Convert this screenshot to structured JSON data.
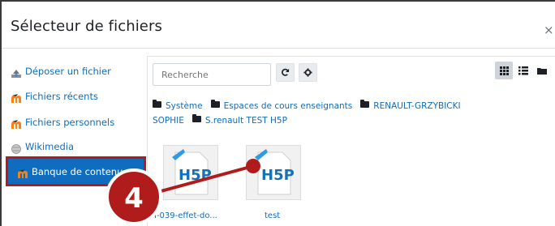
{
  "dialog": {
    "title": "Sélecteur de fichiers",
    "close_label": "×"
  },
  "sidebar": {
    "items": [
      {
        "label": "Déposer un fichier",
        "icon": "upload-icon"
      },
      {
        "label": "Fichiers récents",
        "icon": "moodle-icon"
      },
      {
        "label": "Fichiers personnels",
        "icon": "moodle-icon"
      },
      {
        "label": "Wikimedia",
        "icon": "wikimedia-icon"
      },
      {
        "label": "Banque de contenu",
        "icon": "moodle-icon",
        "active": true
      }
    ]
  },
  "toolbar": {
    "search_placeholder": "Recherche",
    "refresh_icon": "refresh-icon",
    "settings_icon": "gear-icon",
    "view_icons": [
      "grid-view-icon",
      "list-view-icon",
      "tree-view-icon"
    ]
  },
  "breadcrumb": {
    "items": [
      "Système",
      "Espaces de cours enseignants",
      "RENAULT-GRZYBICKI SOPHIE",
      "S.renault TEST H5P"
    ]
  },
  "files": [
    {
      "name": "I-039-effet-do...",
      "type": "H5P"
    },
    {
      "name": "test",
      "type": "H5P"
    }
  ],
  "annotation": {
    "step_number": "4"
  },
  "colors": {
    "link": "#0f6cbf",
    "active_bg": "#0f6cbf",
    "annotation": "#b01c1c"
  }
}
